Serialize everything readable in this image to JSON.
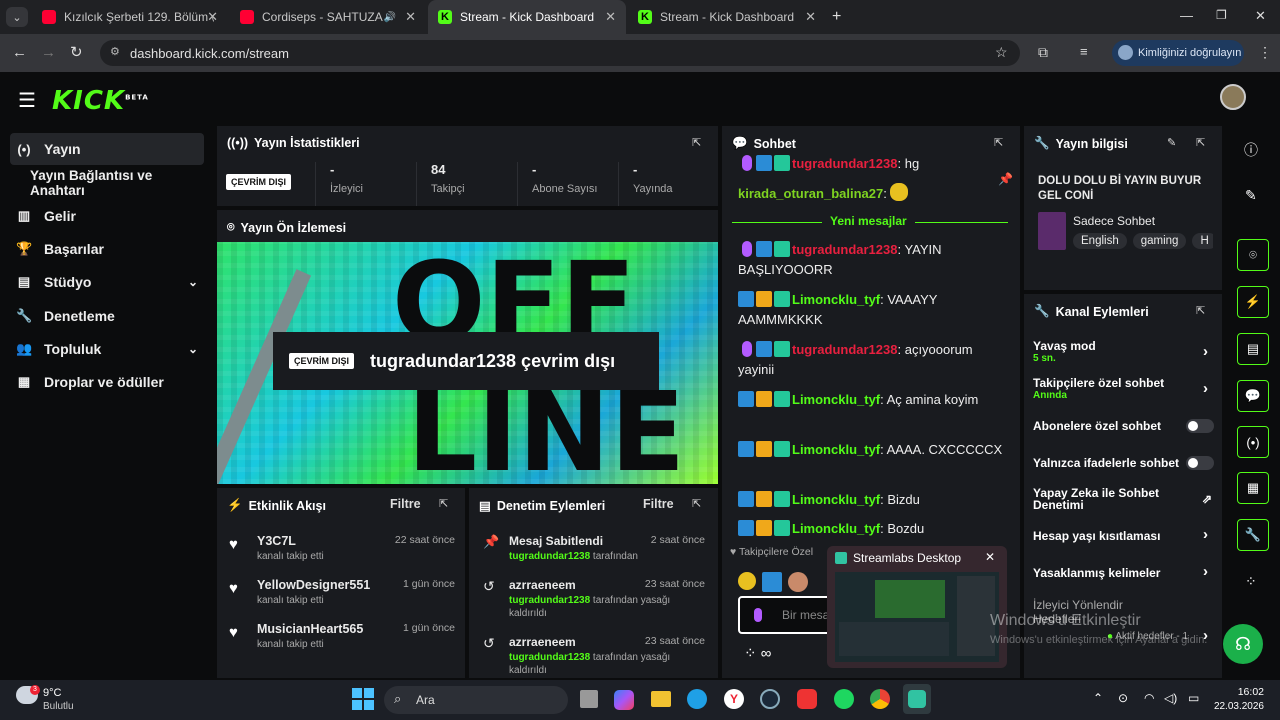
{
  "browser": {
    "tabs": [
      {
        "title": "Kızılcık Şerbeti 129. Bölüm @sh",
        "fav": "yt"
      },
      {
        "title": "Cordiseps - SAHTUZA - You",
        "fav": "yt"
      },
      {
        "title": "Stream - Kick Dashboard",
        "fav": "kick"
      },
      {
        "title": "Stream - Kick Dashboard",
        "fav": "kick"
      }
    ],
    "url": "dashboard.kick.com/stream",
    "verify_label": "Kimliğinizi doğrulayın"
  },
  "app": {
    "logo": "KICK",
    "logo_badge": "BETA"
  },
  "sidebar": {
    "items": [
      {
        "label": "Yayın",
        "icon": "broadcast-icon"
      },
      {
        "label": "Yayın Bağlantısı ve Anahtarı",
        "icon": ""
      },
      {
        "label": "Gelir",
        "icon": "chart-icon"
      },
      {
        "label": "Başarılar",
        "icon": "trophy-icon"
      },
      {
        "label": "Stüdyo",
        "icon": "studio-icon"
      },
      {
        "label": "Denetleme",
        "icon": "wrench-icon"
      },
      {
        "label": "Topluluk",
        "icon": "people-icon"
      },
      {
        "label": "Droplar ve ödüller",
        "icon": "gift-icon"
      }
    ]
  },
  "stats": {
    "title": "Yayın İstatistikleri",
    "status": "ÇEVRİM DIŞI",
    "cells": [
      {
        "value": "-",
        "label": "İzleyici"
      },
      {
        "value": "84",
        "label": "Takipçi"
      },
      {
        "value": "-",
        "label": "Abone Sayısı"
      },
      {
        "value": "-",
        "label": "Yayında"
      }
    ]
  },
  "preview": {
    "title": "Yayın Ön İzlemesi",
    "badge": "ÇEVRİM DIŞI",
    "text": "tugradundar1238 çevrim dışı",
    "bg_text_top": "OFF",
    "bg_text_bottom": "LINE"
  },
  "activity": {
    "title": "Etkinlik Akışı",
    "filter": "Filtre",
    "items": [
      {
        "name": "Y3C7L",
        "sub": "kanalı takip etti",
        "time": "22 saat önce"
      },
      {
        "name": "YellowDesigner551",
        "sub": "kanalı takip etti",
        "time": "1 gün önce"
      },
      {
        "name": "MusicianHeart565",
        "sub": "kanalı takip etti",
        "time": "1 gün önce"
      }
    ]
  },
  "moderation": {
    "title": "Denetim Eylemleri",
    "filter": "Filtre",
    "items": [
      {
        "name": "Mesaj Sabitlendi",
        "by": "tugradundar1238",
        "sub": "tarafından",
        "time": "2 saat önce",
        "sub2": ""
      },
      {
        "name": "azrraeneem",
        "by": "tugradundar1238",
        "sub": "tarafından yasağı",
        "time": "23 saat önce",
        "sub2": "kaldırıldı"
      },
      {
        "name": "azrraeneem",
        "by": "tugradundar1238",
        "sub": "tarafından yasağı",
        "time": "23 saat önce",
        "sub2": "kaldırıldı"
      }
    ]
  },
  "chat": {
    "title": "Sohbet",
    "new_messages": "Yeni mesajlar",
    "messages": [
      {
        "user": "tugradundar1238",
        "text": ": hg"
      },
      {
        "user": "kirada_oturan_balina27",
        "text": ":"
      },
      {
        "user": "tugradundar1238",
        "text": ": YAYIN BAŞLIYOOORR"
      },
      {
        "user": "Limoncklu_tyf",
        "text": ": VAAAYY AAMMMKKKK"
      },
      {
        "user": "tugradundar1238",
        "text": ": açıyooorum yayinii"
      },
      {
        "user": "Limoncklu_tyf",
        "text": ": Aç amina koyim"
      },
      {
        "user": "Limoncklu_tyf",
        "text": ": AAAA. CXCCCCCX"
      },
      {
        "user": "Limoncklu_tyf",
        "text": ": Bizdu"
      },
      {
        "user": "Limoncklu_tyf",
        "text": ": Bozdu"
      }
    ],
    "followers_only": "Takipçilere Özel",
    "placeholder": "Bir mesaj",
    "user_colors": {
      "owner": "#e8203f",
      "green": "#53fc18",
      "balina": "#7ed321"
    }
  },
  "streamlabs": {
    "title": "Streamlabs Desktop"
  },
  "info": {
    "title": "Yayın bilgisi",
    "stream_title": "DOLU DOLU Bİ YAYIN BUYUR GEL CONİ",
    "category": "Sadece Sohbet",
    "tags": [
      "English",
      "gaming",
      "H"
    ]
  },
  "channel": {
    "title": "Kanal Eylemleri",
    "rows": [
      {
        "label": "Yavaş mod",
        "sub": "5 sn.",
        "control": "arrow"
      },
      {
        "label": "Takipçilere özel sohbet",
        "sub": "Anında",
        "control": "arrow"
      },
      {
        "label": "Abonelere özel sohbet",
        "sub": "",
        "control": "toggle"
      },
      {
        "label": "Yalnızca ifadelerle sohbet",
        "sub": "",
        "control": "toggle"
      },
      {
        "label": "Yapay Zeka ile Sohbet Denetimi",
        "sub": "",
        "control": "external"
      },
      {
        "label": "Hesap yaşı kısıtlaması",
        "sub": "",
        "control": "arrow"
      },
      {
        "label": "Yasaklanmış kelimeler",
        "sub": "",
        "control": "arrow"
      },
      {
        "label": "İzleyici Yönlendir Hedefleri",
        "sub": "Aktif hedefler - 1",
        "control": "arrow"
      }
    ]
  },
  "watermark": {
    "line1": "Windows'u Etkinleştir",
    "line2": "Windows'u etkinleştirmek için Ayarlar'a gidin."
  },
  "taskbar": {
    "weather_temp": "9°C",
    "weather_desc": "Bulutlu",
    "search": "Ara",
    "time": "16:02",
    "date": "22.03.2026"
  },
  "colors": {
    "accent": "#53fc18",
    "owner": "#e8203f"
  }
}
